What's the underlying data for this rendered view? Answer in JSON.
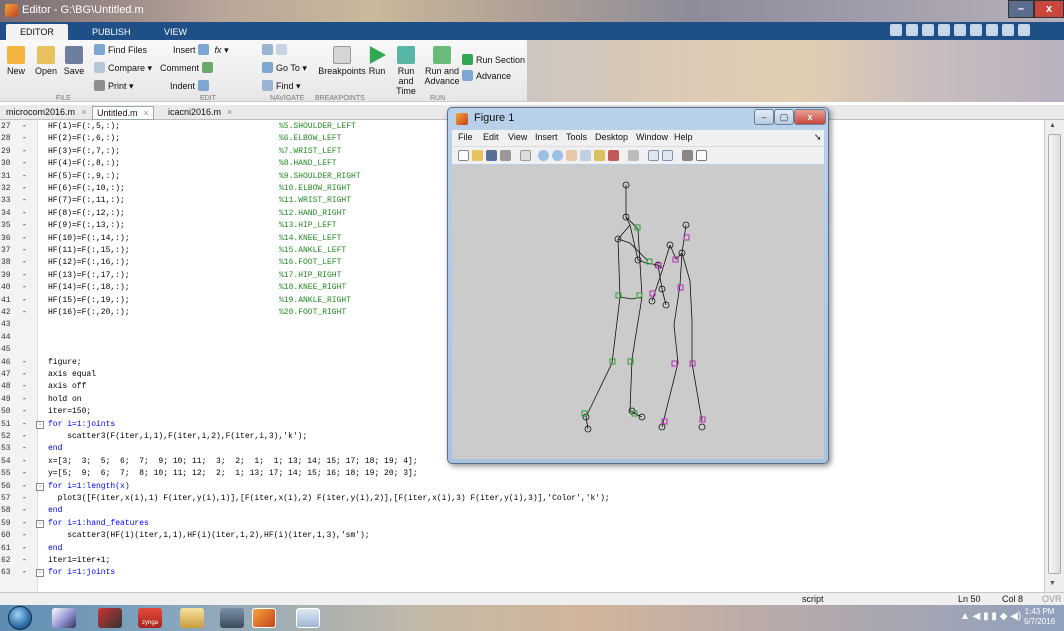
{
  "window": {
    "title": "Editor - G:\\BG\\Untitled.m"
  },
  "toptabs": [
    "EDITOR",
    "PUBLISH",
    "VIEW"
  ],
  "ribbon": {
    "file": {
      "new": "New",
      "open": "Open",
      "save": "Save",
      "find_files": "Find Files",
      "compare": "Compare",
      "print": "Print",
      "label": "FILE"
    },
    "edit": {
      "insert": "Insert",
      "comment": "Comment",
      "indent": "Indent",
      "fx": "fx",
      "label": "EDIT"
    },
    "navigate": {
      "goto": "Go To",
      "find": "Find",
      "label": "NAVIGATE"
    },
    "breakpoints": {
      "label_btn": "Breakpoints",
      "label": "BREAKPOINTS"
    },
    "run": {
      "run": "Run",
      "run_and_time_1": "Run and",
      "run_and_time_2": "Time",
      "run_and_advance_1": "Run and",
      "run_and_advance_2": "Advance",
      "run_section": "Run Section",
      "advance": "Advance",
      "label": "RUN"
    }
  },
  "filetabs": [
    "microcom2016.m",
    "Untitled.m",
    "icacni2016.m"
  ],
  "code_lines": [
    {
      "n": "27",
      "dash": "-",
      "text": "HF(1)=F(:,5,:);",
      "comment": "%5.SHOULDER_LEFT"
    },
    {
      "n": "28",
      "dash": "-",
      "text": "HF(2)=F(:,6,:);",
      "comment": "%6.ELBOW_LEFT"
    },
    {
      "n": "29",
      "dash": "-",
      "text": "HF(3)=F(:,7,:);",
      "comment": "%7.WRIST_LEFT"
    },
    {
      "n": "30",
      "dash": "-",
      "text": "HF(4)=F(:,8,:);",
      "comment": "%8.HAND_LEFT"
    },
    {
      "n": "31",
      "dash": "-",
      "text": "HF(5)=F(:,9,:);",
      "comment": "%9.SHOULDER_RIGHT"
    },
    {
      "n": "32",
      "dash": "-",
      "text": "HF(6)=F(:,10,:);",
      "comment": "%10.ELBOW_RIGHT"
    },
    {
      "n": "33",
      "dash": "-",
      "text": "HF(7)=F(:,11,:);",
      "comment": "%11.WRIST_RIGHT"
    },
    {
      "n": "34",
      "dash": "-",
      "text": "HF(8)=F(:,12,:);",
      "comment": "%12.HAND_RIGHT"
    },
    {
      "n": "35",
      "dash": "-",
      "text": "HF(9)=F(:,13,:);",
      "comment": "%13.HIP_LEFT"
    },
    {
      "n": "36",
      "dash": "-",
      "text": "HF(10)=F(:,14,:);",
      "comment": "%14.KNEE_LEFT"
    },
    {
      "n": "37",
      "dash": "-",
      "text": "HF(11)=F(:,15,:);",
      "comment": "%15.ANKLE_LEFT"
    },
    {
      "n": "38",
      "dash": "-",
      "text": "HF(12)=F(:,16,:);",
      "comment": "%16.FOOT_LEFT"
    },
    {
      "n": "39",
      "dash": "-",
      "text": "HF(13)=F(:,17,:);",
      "comment": "%17.HIP_RIGHT"
    },
    {
      "n": "40",
      "dash": "-",
      "text": "HF(14)=F(:,18,:);",
      "comment": "%18.KNEE_RIGHT"
    },
    {
      "n": "41",
      "dash": "-",
      "text": "HF(15)=F(:,19,:);",
      "comment": "%19.ANKLE_RIGHT"
    },
    {
      "n": "42",
      "dash": "-",
      "text": "HF(16)=F(:,20,:);",
      "comment": "%20.FOOT_RIGHT"
    },
    {
      "n": "43",
      "dash": "",
      "text": "",
      "comment": ""
    },
    {
      "n": "44",
      "dash": "",
      "text": "",
      "comment": ""
    },
    {
      "n": "45",
      "dash": "",
      "text": "",
      "comment": ""
    },
    {
      "n": "46",
      "dash": "-",
      "text": "figure;",
      "comment": ""
    },
    {
      "n": "47",
      "dash": "-",
      "text": "axis equal",
      "comment": ""
    },
    {
      "n": "48",
      "dash": "-",
      "text": "axis off",
      "comment": ""
    },
    {
      "n": "49",
      "dash": "-",
      "text": "hold on",
      "comment": ""
    },
    {
      "n": "50",
      "dash": "-",
      "text": "iter=150;",
      "comment": ""
    },
    {
      "n": "51",
      "dash": "-",
      "text": "for i=1:joints",
      "comment": "",
      "fold": true
    },
    {
      "n": "52",
      "dash": "-",
      "text": "    scatter3(F(iter,i,1),F(iter,i,2),F(iter,i,3),'k');",
      "comment": ""
    },
    {
      "n": "53",
      "dash": "-",
      "text": "end",
      "comment": ""
    },
    {
      "n": "54",
      "dash": "-",
      "text": "x=[3;  3;  5;  6;  7;  9; 10; 11;  3;  2;  1;  1; 13; 14; 15; 17; 18; 19; 4];",
      "comment": ""
    },
    {
      "n": "55",
      "dash": "-",
      "text": "y=[5;  9;  6;  7;  8; 10; 11; 12;  2;  1; 13; 17; 14; 15; 16; 18; 19; 20; 3];",
      "comment": ""
    },
    {
      "n": "56",
      "dash": "-",
      "text": "for i=1:length(x)",
      "comment": "",
      "fold": true
    },
    {
      "n": "57",
      "dash": "-",
      "text": "  plot3([F(iter,x(i),1) F(iter,y(i),1)],[F(iter,x(i),2) F(iter,y(i),2)],[F(iter,x(i),3) F(iter,y(i),3)],'Color','k');",
      "comment": ""
    },
    {
      "n": "58",
      "dash": "-",
      "text": "end",
      "comment": ""
    },
    {
      "n": "59",
      "dash": "-",
      "text": "for i=1:hand_features",
      "comment": "",
      "fold": true
    },
    {
      "n": "60",
      "dash": "-",
      "text": "    scatter3(HF(i)(iter,1,1),HF(i)(iter,1,2),HF(i)(iter,1,3),'sm');",
      "comment": ""
    },
    {
      "n": "61",
      "dash": "-",
      "text": "end",
      "comment": ""
    },
    {
      "n": "62",
      "dash": "-",
      "text": "iter1=iter+1;",
      "comment": ""
    },
    {
      "n": "63",
      "dash": "-",
      "text": "for i=1:joints",
      "comment": "",
      "fold": true
    }
  ],
  "status": {
    "mode": "script",
    "ln": "Ln  50",
    "col": "Col  8",
    "ovr": "OVR"
  },
  "taskbar": {
    "time": "1:43 PM",
    "date": "5/7/2016",
    "zynga": "zynga"
  },
  "figure": {
    "title": "Figure 1",
    "menu": [
      "File",
      "Edit",
      "View",
      "Insert",
      "Tools",
      "Desktop",
      "Window",
      "Help"
    ],
    "colors": {
      "skeleton_left": "#2aa02a",
      "skeleton_right": "#b32bb3",
      "joints": "#000000"
    }
  }
}
